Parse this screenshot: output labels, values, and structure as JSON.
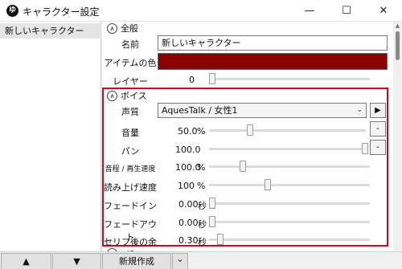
{
  "window": {
    "app_icon": "ゆ",
    "title": "キャラクター設定",
    "minimize": "—",
    "maximize": "☐",
    "close": "✕"
  },
  "character_list": {
    "items": [
      {
        "label": "新しいキャラクター"
      }
    ]
  },
  "general": {
    "header": "全般",
    "name_label": "名前",
    "name_value": "新しいキャラクター",
    "item_color_label": "アイテムの色",
    "item_color": "#8b0000",
    "layer_label": "レイヤー",
    "layer_value": "0",
    "layer_level": 0
  },
  "voice": {
    "header": "ボイス",
    "voice_label": "声質",
    "voice_value": "AquesTalk / 女性1",
    "play": "▶",
    "volume_label": "音量",
    "volume_value": "50.0",
    "volume_unit": "%",
    "volume_level": 0.25,
    "pan_label": "パン",
    "pan_value": "100.0",
    "pan_level": 1.0,
    "pitch_label": "音程 / 再生速度",
    "pitch_value": "100.0",
    "pitch_unit": "%",
    "pitch_level": 0.2,
    "speed_label": "読み上げ速度",
    "speed_value": "100",
    "speed_unit": "%",
    "speed_level": 0.36,
    "fadein_label": "フェードイン",
    "fadein_value": "0.00",
    "fadein_unit": "秒",
    "fadein_level": 0,
    "fadeout_label": "フェードアウト",
    "fadeout_value": "0.00",
    "fadeout_unit": "秒",
    "fadeout_level": 0,
    "margin_label": "セリフ後の余韻",
    "margin_value": "0.30",
    "margin_unit": "秒",
    "margin_level": 0.05,
    "minus": "-"
  },
  "bottom": {
    "up": "▲",
    "down": "▼",
    "new": "新規作成",
    "dropdown": "⌄"
  }
}
